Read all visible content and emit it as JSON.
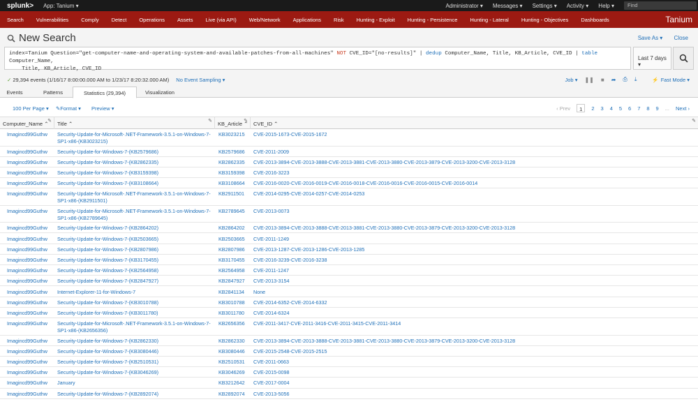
{
  "topbar": {
    "logo": "splunk>",
    "app": "App: Tanium ▾",
    "menu": [
      "Administrator ▾",
      "Messages ▾",
      "Settings ▾",
      "Activity ▾",
      "Help ▾"
    ],
    "find_placeholder": "Find"
  },
  "nav": {
    "items": [
      "Search",
      "Vulnerabilities",
      "Comply",
      "Detect",
      "Operations",
      "Assets",
      "Live (via API)",
      "Web/Network",
      "Applications",
      "Risk",
      "Hunting - Exploit",
      "Hunting - Persistence",
      "Hunting - Lateral",
      "Hunting - Objectives",
      "Dashboards"
    ],
    "brand": "Tanium"
  },
  "header": {
    "title": "New Search",
    "save_as": "Save As ▾",
    "close": "Close"
  },
  "search": {
    "q1a": "index=Tanium Question=\"get-computer-name-and-operating-system-and-available-patches-from-all-machines\" ",
    "q1not": "NOT",
    "q1b": " CVE_ID=\"[no-results]\" | ",
    "q1dedup": "dedup",
    "q1c": " Computer_Name, Title, KB_Article, CVE_ID | ",
    "q1table": "table",
    "q1d": " Computer_Name,",
    "q2": "    Title, KB_Article, CVE_ID",
    "time_range": "Last 7 days ▾"
  },
  "status": {
    "events": "29,394 events (1/16/17 8:00:00.000 AM to 1/23/17 8:20:32.000 AM)",
    "sampling": "No Event Sampling ▾",
    "job": "Job ▾",
    "mode": "Fast Mode ▾"
  },
  "tabs": [
    "Events",
    "Patterns",
    "Statistics (29,394)",
    "Visualization"
  ],
  "controls": {
    "per_page": "100 Per Page ▾",
    "format": "✎Format ▾",
    "preview": "Preview ▾",
    "prev": "‹ Prev",
    "pages": [
      "1",
      "2",
      "3",
      "4",
      "5",
      "6",
      "7",
      "8",
      "9",
      "..."
    ],
    "next": "Next ›"
  },
  "table": {
    "headers": [
      "Computer_Name ⌃",
      "Title ⌃",
      "KB_Article ⌃",
      "CVE_ID ⌃"
    ],
    "rows": [
      [
        "Imagincd99Guthw",
        "Security-Update-for-Microsoft-.NET-Framework-3.5.1-on-Windows-7-SP1-x86-(KB3023215)",
        "KB3023215",
        "CVE-2015-1673-CVE-2015-1672"
      ],
      [
        "Imagincd99Guthw",
        "Security-Update-for-Windows-7-(KB2579686)",
        "KB2579686",
        "CVE-2011-2009"
      ],
      [
        "Imagincd99Guthw",
        "Security-Update-for-Windows-7-(KB2862335)",
        "KB2862335",
        "CVE-2013-3894-CVE-2013-3888-CVE-2013-3881-CVE-2013-3880-CVE-2013-3879-CVE-2013-3200-CVE-2013-3128"
      ],
      [
        "Imagincd99Guthw",
        "Security-Update-for-Windows-7-(KB3159398)",
        "KB3159398",
        "CVE-2016-3223"
      ],
      [
        "Imagincd99Guthw",
        "Security-Update-for-Windows-7-(KB3108664)",
        "KB3108664",
        "CVE-2016-0020-CVE-2016-0019-CVE-2016-0018-CVE-2016-0016-CVE-2016-0015-CVE-2016-0014"
      ],
      [
        "Imagincd99Guthw",
        "Security-Update-for-Microsoft-.NET-Framework-3.5.1-on-Windows-7-SP1-x86-(KB2911501)",
        "KB2911501",
        "CVE-2014-0295-CVE-2014-0257-CVE-2014-0253"
      ],
      [
        "Imagincd99Guthw",
        "Security-Update-for-Microsoft-.NET-Framework-3.5.1-on-Windows-7-SP1-x86-(KB2789645)",
        "KB2789645",
        "CVE-2013-0073"
      ],
      [
        "Imagincd99Guthw",
        "Security-Update-for-Windows-7-(KB2864202)",
        "KB2864202",
        "CVE-2013-3894-CVE-2013-3888-CVE-2013-3881-CVE-2013-3880-CVE-2013-3879-CVE-2013-3200-CVE-2013-3128"
      ],
      [
        "Imagincd99Guthw",
        "Security-Update-for-Windows-7-(KB2503665)",
        "KB2503665",
        "CVE-2011-1249"
      ],
      [
        "Imagincd99Guthw",
        "Security-Update-for-Windows-7-(KB2807986)",
        "KB2807986",
        "CVE-2013-1287-CVE-2013-1286-CVE-2013-1285"
      ],
      [
        "Imagincd99Guthw",
        "Security-Update-for-Windows-7-(KB3170455)",
        "KB3170455",
        "CVE-2016-3239-CVE-2016-3238"
      ],
      [
        "Imagincd99Guthw",
        "Security-Update-for-Windows-7-(KB2564958)",
        "KB2564958",
        "CVE-2011-1247"
      ],
      [
        "Imagincd99Guthw",
        "Security-Update-for-Windows-7-(KB2847927)",
        "KB2847927",
        "CVE-2013-3154"
      ],
      [
        "Imagincd99Guthw",
        "Internet-Explorer-11-for-Windows-7",
        "KB2841134",
        "None"
      ],
      [
        "Imagincd99Guthw",
        "Security-Update-for-Windows-7-(KB3010788)",
        "KB3010788",
        "CVE-2014-6352-CVE-2014-6332"
      ],
      [
        "Imagincd99Guthw",
        "Security-Update-for-Windows-7-(KB3011780)",
        "KB3011780",
        "CVE-2014-6324"
      ],
      [
        "Imagincd99Guthw",
        "Security-Update-for-Microsoft-.NET-Framework-3.5.1-on-Windows-7-SP1-x86-(KB2656356)",
        "KB2656356",
        "CVE-2011-3417-CVE-2011-3416-CVE-2011-3415-CVE-2011-3414"
      ],
      [
        "Imagincd99Guthw",
        "Security-Update-for-Windows-7-(KB2862330)",
        "KB2862330",
        "CVE-2013-3894-CVE-2013-3888-CVE-2013-3881-CVE-2013-3880-CVE-2013-3879-CVE-2013-3200-CVE-2013-3128"
      ],
      [
        "Imagincd99Guthw",
        "Security-Update-for-Windows-7-(KB3080446)",
        "KB3080446",
        "CVE-2015-2548-CVE-2015-2515"
      ],
      [
        "Imagincd99Guthw",
        "Security-Update-for-Windows-7-(KB2510531)",
        "KB2510531",
        "CVE-2011-0663"
      ],
      [
        "Imagincd99Guthw",
        "Security-Update-for-Windows-7-(KB3046269)",
        "KB3046269",
        "CVE-2015-0098"
      ],
      [
        "Imagincd99Guthw",
        "January",
        "KB3212642",
        "CVE-2017-0004"
      ],
      [
        "Imagincd99Guthw",
        "Security-Update-for-Windows-7-(KB2892074)",
        "KB2892074",
        "CVE-2013-5056"
      ]
    ]
  },
  "icons": {
    "search": "magnifier-icon",
    "pause": "pause-icon",
    "stop": "stop-icon",
    "share": "share-icon",
    "print": "print-icon",
    "export": "download-icon",
    "mode": "lightning-icon"
  },
  "colors": {
    "nav_red": "#9c1a12",
    "topbar": "#1a1a1a",
    "link": "#1e6fb8",
    "success": "#5a9e2f"
  }
}
